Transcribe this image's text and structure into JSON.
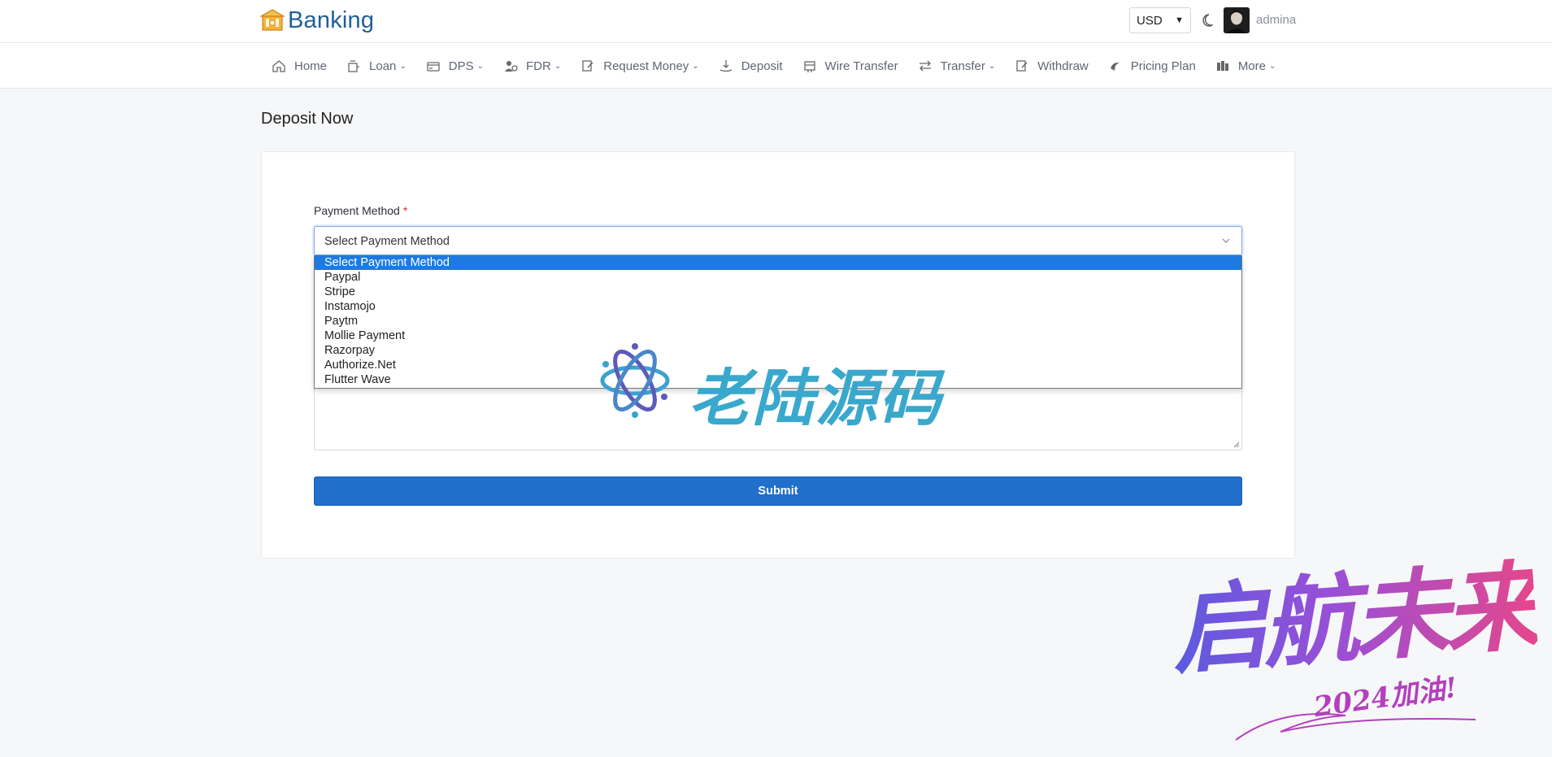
{
  "header": {
    "brand": "Banking",
    "currency": "USD",
    "username": "admina"
  },
  "nav": {
    "items": [
      {
        "label": "Home",
        "icon": "home-icon",
        "caret": false
      },
      {
        "label": "Loan",
        "icon": "loan-icon",
        "caret": true
      },
      {
        "label": "DPS",
        "icon": "dps-icon",
        "caret": true
      },
      {
        "label": "FDR",
        "icon": "fdr-icon",
        "caret": true
      },
      {
        "label": "Request Money",
        "icon": "request-money-icon",
        "caret": true
      },
      {
        "label": "Deposit",
        "icon": "deposit-icon",
        "caret": false
      },
      {
        "label": "Wire Transfer",
        "icon": "wire-transfer-icon",
        "caret": false
      },
      {
        "label": "Transfer",
        "icon": "transfer-icon",
        "caret": true
      },
      {
        "label": "Withdraw",
        "icon": "withdraw-icon",
        "caret": false
      },
      {
        "label": "Pricing Plan",
        "icon": "pricing-plan-icon",
        "caret": false
      },
      {
        "label": "More",
        "icon": "more-icon",
        "caret": true
      }
    ]
  },
  "page": {
    "title": "Deposit Now"
  },
  "form": {
    "payment_method_label": "Payment Method",
    "required_mark": "*",
    "selected_value": "Select Payment Method",
    "options": [
      "Select Payment Method",
      "Paypal",
      "Stripe",
      "Instamojo",
      "Paytm",
      "Mollie Payment",
      "Razorpay",
      "Authorize.Net",
      "Flutter Wave"
    ],
    "submit_label": "Submit"
  },
  "watermarks": {
    "center_text": "老陆源码",
    "corner_text": "启航未来",
    "corner_subtext": "2024加油!"
  },
  "colors": {
    "brand": "#1f5f9b",
    "primary": "#1f6fcb",
    "option_highlight": "#1e7ae0",
    "required": "#dc2626"
  }
}
